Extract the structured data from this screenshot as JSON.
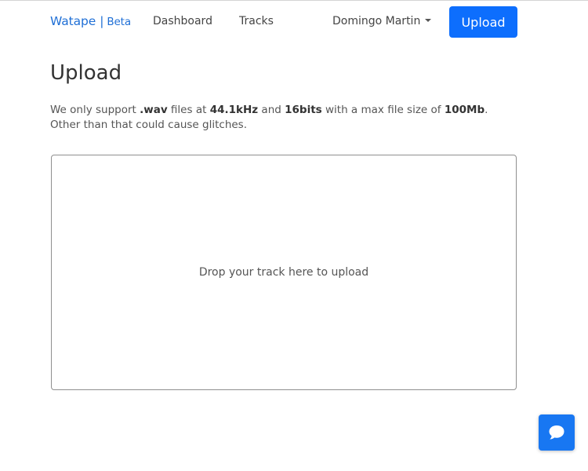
{
  "navbar": {
    "brand": "Watape",
    "brand_separator": "|",
    "brand_tag": "Beta",
    "links": [
      {
        "label": "Dashboard"
      },
      {
        "label": "Tracks"
      }
    ],
    "user_name": "Domingo Martin",
    "upload_label": "Upload"
  },
  "page": {
    "title": "Upload",
    "description": {
      "part1": "We only support ",
      "format": ".wav",
      "part2": " files at ",
      "sample_rate": "44.1kHz",
      "part3": " and ",
      "bit_depth": "16bits",
      "part4": " with a max file size of ",
      "max_size": "100Mb",
      "part5": ". Other than that could cause glitches."
    },
    "dropzone_text": "Drop your track here to upload"
  },
  "chat": {
    "icon": "chat-bubble-icon"
  },
  "colors": {
    "brand": "#1f6fd6",
    "primary": "#0d6efd",
    "chat": "#1877f2",
    "text": "#333333"
  }
}
